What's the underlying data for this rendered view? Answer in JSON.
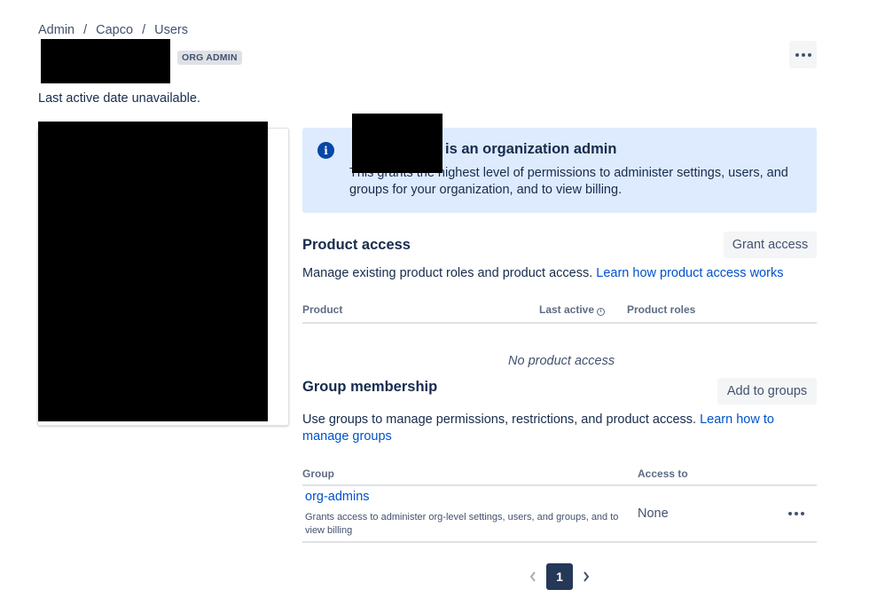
{
  "breadcrumb": {
    "items": [
      "Admin",
      "Capco",
      "Users"
    ],
    "separator": "/"
  },
  "header": {
    "role_badge": "ORG ADMIN",
    "more_icon": "more-horizontal-icon"
  },
  "last_active_text": "Last active date unavailable.",
  "org_admin_notice": {
    "icon": "info-icon",
    "title_suffix": "is an organization admin",
    "body": "This grants the highest level of permissions to administer settings, users, and groups for your organization, and to view billing."
  },
  "product_access": {
    "title": "Product access",
    "button_label": "Grant access",
    "description": "Manage existing product roles and product access.",
    "link_text": "Learn how product access works",
    "columns": [
      "Product",
      "Last active",
      "Product roles"
    ],
    "empty_message": "No product access"
  },
  "group_membership": {
    "title": "Group membership",
    "button_label": "Add to groups",
    "description": "Use groups to manage permissions, restrictions, and product access.",
    "link_text": "Learn how to manage groups",
    "columns": [
      "Group",
      "Access to"
    ],
    "rows": [
      {
        "name": "org-admins",
        "description": "Grants access to administer org-level settings, users, and groups, and to view billing",
        "access": "None"
      }
    ]
  },
  "pagination": {
    "current_page": "1",
    "prev_icon": "chevron-left-icon",
    "next_icon": "chevron-right-icon"
  },
  "colors": {
    "link": "#0052cc",
    "info_bg": "#deebff",
    "info_icon": "#0747a6",
    "active_page": "#253858"
  }
}
